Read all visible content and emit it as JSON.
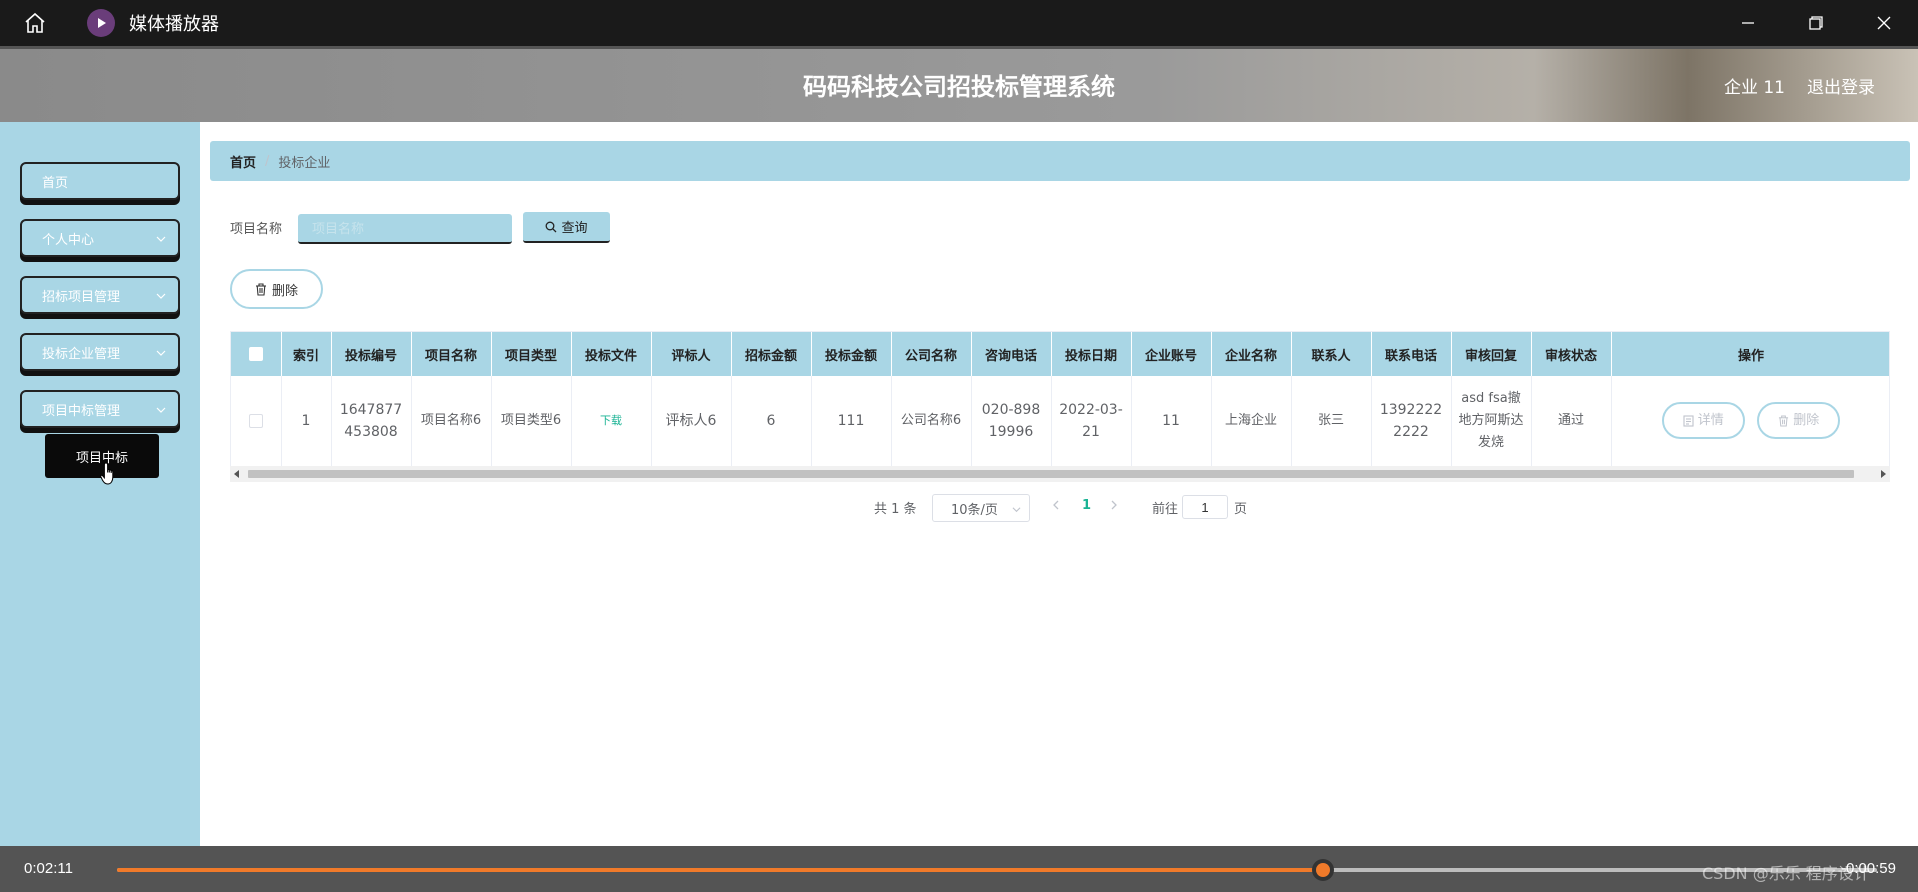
{
  "player": {
    "title": "媒体播放器",
    "current_time": "0:02:11",
    "remaining_time": "-0:00:59",
    "progress": 0.685,
    "accent_color": "#f07a2a"
  },
  "header": {
    "title": "码码科技公司招投标管理系统",
    "user": "企业 11",
    "logout": "退出登录"
  },
  "sidebar": {
    "items": [
      {
        "label": "首页"
      },
      {
        "label": "个人中心"
      },
      {
        "label": "招标项目管理"
      },
      {
        "label": "投标企业管理"
      },
      {
        "label": "项目中标管理"
      }
    ],
    "submenu": {
      "label": "项目中标"
    }
  },
  "breadcrumb": {
    "home": "首页",
    "current": "投标企业"
  },
  "search": {
    "label": "项目名称",
    "placeholder": "项目名称",
    "button": "查询"
  },
  "toolbar": {
    "delete": "删除"
  },
  "table": {
    "headers": [
      "索引",
      "投标编号",
      "项目名称",
      "项目类型",
      "投标文件",
      "评标人",
      "招标金额",
      "投标金额",
      "公司名称",
      "咨询电话",
      "投标日期",
      "企业账号",
      "企业名称",
      "联系人",
      "联系电话",
      "审核回复",
      "审核状态",
      "操作"
    ],
    "rows": [
      {
        "index": "1",
        "bid_no": "1647877453808",
        "project_name": "项目名称6",
        "project_type": "项目类型6",
        "bid_file": "下载",
        "evaluator": "评标人6",
        "tender_amount": "6",
        "bid_amount": "111",
        "company_name": "公司名称6",
        "consult_phone": "020-89819996",
        "bid_date": "2022-03-21",
        "account": "11",
        "enterprise_name": "上海企业",
        "contact": "张三",
        "contact_phone": "13922222222",
        "review_reply": "asd fsa撤地方阿斯达发烧",
        "review_status": "通过",
        "detail_btn": "详情",
        "delete_btn": "删除"
      }
    ]
  },
  "pagination": {
    "total": "共 1 条",
    "page_size": "10条/页",
    "current_page": "1",
    "goto_label": "前往",
    "goto_value": "1",
    "goto_suffix": "页"
  },
  "watermark": "CSDN @乐乐 程序设计",
  "colors": {
    "theme": "#a9d6e5",
    "link": "#1ab394"
  }
}
